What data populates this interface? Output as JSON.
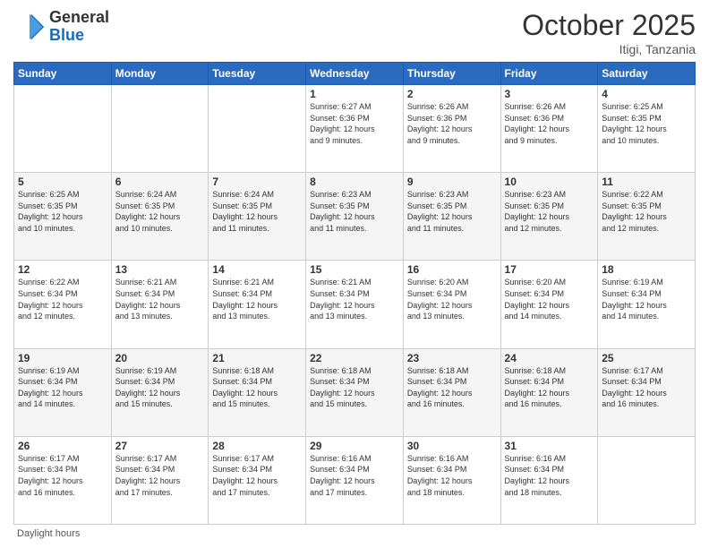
{
  "header": {
    "logo_general": "General",
    "logo_blue": "Blue",
    "month_title": "October 2025",
    "subtitle": "Itigi, Tanzania"
  },
  "footer": {
    "daylight_label": "Daylight hours"
  },
  "days_of_week": [
    "Sunday",
    "Monday",
    "Tuesday",
    "Wednesday",
    "Thursday",
    "Friday",
    "Saturday"
  ],
  "weeks": [
    [
      {
        "day": "",
        "info": ""
      },
      {
        "day": "",
        "info": ""
      },
      {
        "day": "",
        "info": ""
      },
      {
        "day": "1",
        "info": "Sunrise: 6:27 AM\nSunset: 6:36 PM\nDaylight: 12 hours\nand 9 minutes."
      },
      {
        "day": "2",
        "info": "Sunrise: 6:26 AM\nSunset: 6:36 PM\nDaylight: 12 hours\nand 9 minutes."
      },
      {
        "day": "3",
        "info": "Sunrise: 6:26 AM\nSunset: 6:36 PM\nDaylight: 12 hours\nand 9 minutes."
      },
      {
        "day": "4",
        "info": "Sunrise: 6:25 AM\nSunset: 6:35 PM\nDaylight: 12 hours\nand 10 minutes."
      }
    ],
    [
      {
        "day": "5",
        "info": "Sunrise: 6:25 AM\nSunset: 6:35 PM\nDaylight: 12 hours\nand 10 minutes."
      },
      {
        "day": "6",
        "info": "Sunrise: 6:24 AM\nSunset: 6:35 PM\nDaylight: 12 hours\nand 10 minutes."
      },
      {
        "day": "7",
        "info": "Sunrise: 6:24 AM\nSunset: 6:35 PM\nDaylight: 12 hours\nand 11 minutes."
      },
      {
        "day": "8",
        "info": "Sunrise: 6:23 AM\nSunset: 6:35 PM\nDaylight: 12 hours\nand 11 minutes."
      },
      {
        "day": "9",
        "info": "Sunrise: 6:23 AM\nSunset: 6:35 PM\nDaylight: 12 hours\nand 11 minutes."
      },
      {
        "day": "10",
        "info": "Sunrise: 6:23 AM\nSunset: 6:35 PM\nDaylight: 12 hours\nand 12 minutes."
      },
      {
        "day": "11",
        "info": "Sunrise: 6:22 AM\nSunset: 6:35 PM\nDaylight: 12 hours\nand 12 minutes."
      }
    ],
    [
      {
        "day": "12",
        "info": "Sunrise: 6:22 AM\nSunset: 6:34 PM\nDaylight: 12 hours\nand 12 minutes."
      },
      {
        "day": "13",
        "info": "Sunrise: 6:21 AM\nSunset: 6:34 PM\nDaylight: 12 hours\nand 13 minutes."
      },
      {
        "day": "14",
        "info": "Sunrise: 6:21 AM\nSunset: 6:34 PM\nDaylight: 12 hours\nand 13 minutes."
      },
      {
        "day": "15",
        "info": "Sunrise: 6:21 AM\nSunset: 6:34 PM\nDaylight: 12 hours\nand 13 minutes."
      },
      {
        "day": "16",
        "info": "Sunrise: 6:20 AM\nSunset: 6:34 PM\nDaylight: 12 hours\nand 13 minutes."
      },
      {
        "day": "17",
        "info": "Sunrise: 6:20 AM\nSunset: 6:34 PM\nDaylight: 12 hours\nand 14 minutes."
      },
      {
        "day": "18",
        "info": "Sunrise: 6:19 AM\nSunset: 6:34 PM\nDaylight: 12 hours\nand 14 minutes."
      }
    ],
    [
      {
        "day": "19",
        "info": "Sunrise: 6:19 AM\nSunset: 6:34 PM\nDaylight: 12 hours\nand 14 minutes."
      },
      {
        "day": "20",
        "info": "Sunrise: 6:19 AM\nSunset: 6:34 PM\nDaylight: 12 hours\nand 15 minutes."
      },
      {
        "day": "21",
        "info": "Sunrise: 6:18 AM\nSunset: 6:34 PM\nDaylight: 12 hours\nand 15 minutes."
      },
      {
        "day": "22",
        "info": "Sunrise: 6:18 AM\nSunset: 6:34 PM\nDaylight: 12 hours\nand 15 minutes."
      },
      {
        "day": "23",
        "info": "Sunrise: 6:18 AM\nSunset: 6:34 PM\nDaylight: 12 hours\nand 16 minutes."
      },
      {
        "day": "24",
        "info": "Sunrise: 6:18 AM\nSunset: 6:34 PM\nDaylight: 12 hours\nand 16 minutes."
      },
      {
        "day": "25",
        "info": "Sunrise: 6:17 AM\nSunset: 6:34 PM\nDaylight: 12 hours\nand 16 minutes."
      }
    ],
    [
      {
        "day": "26",
        "info": "Sunrise: 6:17 AM\nSunset: 6:34 PM\nDaylight: 12 hours\nand 16 minutes."
      },
      {
        "day": "27",
        "info": "Sunrise: 6:17 AM\nSunset: 6:34 PM\nDaylight: 12 hours\nand 17 minutes."
      },
      {
        "day": "28",
        "info": "Sunrise: 6:17 AM\nSunset: 6:34 PM\nDaylight: 12 hours\nand 17 minutes."
      },
      {
        "day": "29",
        "info": "Sunrise: 6:16 AM\nSunset: 6:34 PM\nDaylight: 12 hours\nand 17 minutes."
      },
      {
        "day": "30",
        "info": "Sunrise: 6:16 AM\nSunset: 6:34 PM\nDaylight: 12 hours\nand 18 minutes."
      },
      {
        "day": "31",
        "info": "Sunrise: 6:16 AM\nSunset: 6:34 PM\nDaylight: 12 hours\nand 18 minutes."
      },
      {
        "day": "",
        "info": ""
      }
    ]
  ]
}
